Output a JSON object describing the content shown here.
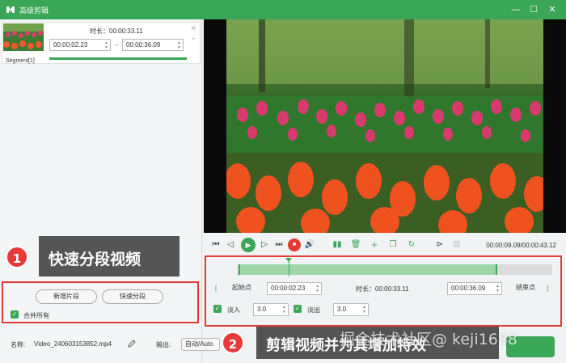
{
  "window": {
    "title": "高级剪辑",
    "min": "—",
    "max": "☐",
    "close": "✕"
  },
  "segment": {
    "label": "Segment[1]",
    "duration": "时长：00:00:33.11",
    "start": "00:00:02.23",
    "end": "00:00:36.09",
    "dash": "–",
    "progress": 1.0
  },
  "callouts": [
    {
      "num": "1",
      "text": "快速分段视频"
    },
    {
      "num": "2",
      "text": "剪辑视频并为其增加特效"
    }
  ],
  "left_actions": {
    "new_segment": "新增片段",
    "quick_split": "快速分段",
    "merge_all": "合并所有"
  },
  "footer": {
    "name_label": "名称:",
    "file_name": "Video_240603153852.mp4",
    "output_label": "输出:",
    "output_value": "自动/Auto"
  },
  "player": {
    "time": "00:00:09.09/00:00:43.12",
    "icons": [
      "skip-start-icon",
      "prev-frame-icon",
      "play-icon",
      "next-frame-icon",
      "skip-end-icon",
      "stop-icon",
      "volume-icon",
      "split-icon",
      "delete-icon",
      "add-icon",
      "copy-icon",
      "reset-icon",
      "mark-in-icon",
      "mark-out-icon"
    ]
  },
  "trim": {
    "start_label": "起始点",
    "start_value": "00:00:02.23",
    "duration": "时长：00:00:33.11",
    "end_value": "00:00:36.09",
    "end_label": "结束点",
    "fade_in_label": "淡入",
    "fade_in_value": "3.0",
    "fade_out_label": "淡出",
    "fade_out_value": "3.0"
  },
  "watermark": "掘金技术社区@ keji1688",
  "colors": {
    "accent": "#3aa657",
    "callout_red": "#e83a3a",
    "frame_red": "#e53935"
  }
}
